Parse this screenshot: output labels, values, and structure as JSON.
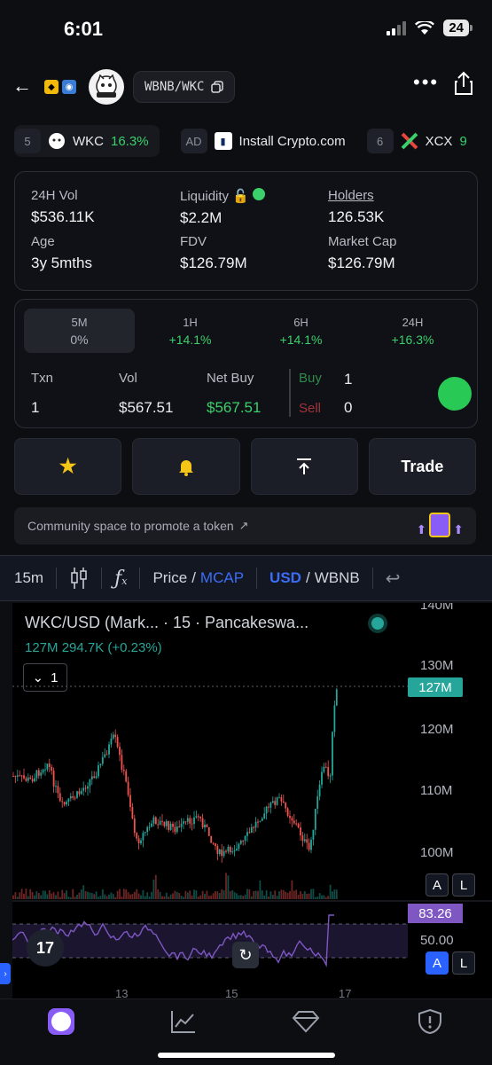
{
  "status": {
    "time": "6:01",
    "battery": "24"
  },
  "header": {
    "pair": "WBNB/WKC",
    "logo_text": "Wiki Cat"
  },
  "trending": [
    {
      "rank": "5",
      "symbol": "WKC",
      "change": "16.3%"
    },
    {
      "rank": "AD",
      "label": "Install Crypto.com"
    },
    {
      "rank": "6",
      "symbol": "XCX",
      "change": "9"
    }
  ],
  "stats": {
    "vol_label": "24H Vol",
    "vol": "$536.11K",
    "liq_label": "Liquidity",
    "liq": "$2.2M",
    "holders_label": "Holders",
    "holders": "126.53K",
    "age_label": "Age",
    "age": "3y 5mths",
    "fdv_label": "FDV",
    "fdv": "$126.79M",
    "mcap_label": "Market Cap",
    "mcap": "$126.79M"
  },
  "timeframes": [
    {
      "label": "5M",
      "change": "0%"
    },
    {
      "label": "1H",
      "change": "+14.1%"
    },
    {
      "label": "6H",
      "change": "+14.1%"
    },
    {
      "label": "24H",
      "change": "+16.3%"
    }
  ],
  "txn": {
    "txn_label": "Txn",
    "txn": "1",
    "vol_label": "Vol",
    "vol": "$567.51",
    "net_label": "Net Buy",
    "net": "$567.51",
    "buy_label": "Buy",
    "buy": "1",
    "sell_label": "Sell",
    "sell": "0"
  },
  "actions": {
    "trade": "Trade"
  },
  "promo": {
    "text": "Community space to promote a token"
  },
  "toolbar": {
    "interval": "15m",
    "price": "Price",
    "slash": "/",
    "mcap": "MCAP",
    "usd": "USD",
    "wbnb": "WBNB"
  },
  "chart": {
    "title": "WKC/USD (Mark... · 15 · Pancakeswa...",
    "values": "127M  294.7K (+0.23%)",
    "collapse_count": "1",
    "y_labels": [
      "140M",
      "130M",
      "120M",
      "110M",
      "100M"
    ],
    "price_tag": "127M",
    "rsi_tag": "83.26",
    "rsi_mid": "50.00",
    "x_labels": [
      "13",
      "15",
      "17"
    ],
    "auto": "A",
    "log": "L"
  },
  "colors": {
    "up": "#26a69a",
    "down": "#ef5350",
    "rsi": "#7e57c2",
    "accent_blue": "#3d6cf6",
    "green": "#3ad06b"
  }
}
